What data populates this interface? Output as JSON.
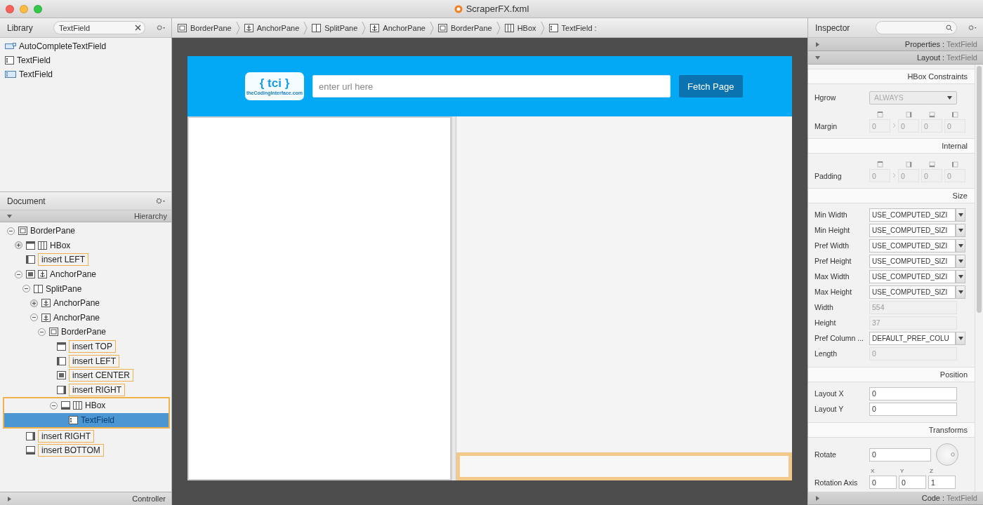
{
  "window": {
    "title": "ScraperFX.fxml"
  },
  "library": {
    "title": "Library",
    "search": {
      "value": "TextField"
    },
    "items": [
      {
        "label": "AutoCompleteTextField",
        "kind": "autocomplete"
      },
      {
        "label": "TextField",
        "kind": "textfield"
      },
      {
        "label": "TextField",
        "kind": "textfield-blue"
      }
    ]
  },
  "document": {
    "title": "Document",
    "section": "Hierarchy",
    "footer": "Controller",
    "tree": [
      {
        "label": "BorderPane",
        "kind": "borderpane",
        "expanded": true,
        "selected": false,
        "outlined": false,
        "children": [
          {
            "label": "HBox",
            "kind": "top-hbox",
            "expanded": false,
            "selected": false,
            "outlined": false
          },
          {
            "label": "insert LEFT",
            "kind": "slot-left"
          },
          {
            "label": "AnchorPane",
            "kind": "center-anchorpane",
            "expanded": true,
            "selected": false,
            "outlined": false,
            "children": [
              {
                "label": "SplitPane",
                "kind": "splitpane",
                "expanded": true,
                "selected": false,
                "outlined": false,
                "children": [
                  {
                    "label": "AnchorPane",
                    "kind": "anchorpane",
                    "expanded": false,
                    "selected": false,
                    "outlined": false
                  },
                  {
                    "label": "AnchorPane",
                    "kind": "anchorpane",
                    "expanded": true,
                    "selected": false,
                    "outlined": false,
                    "children": [
                      {
                        "label": "BorderPane",
                        "kind": "borderpane",
                        "expanded": true,
                        "selected": false,
                        "outlined": false,
                        "children": [
                          {
                            "label": "insert TOP",
                            "kind": "slot-top"
                          },
                          {
                            "label": "insert LEFT",
                            "kind": "slot-left"
                          },
                          {
                            "label": "insert CENTER",
                            "kind": "slot-center"
                          },
                          {
                            "label": "insert RIGHT",
                            "kind": "slot-right"
                          },
                          {
                            "label": "HBox",
                            "kind": "bottom-hbox",
                            "expanded": true,
                            "selected": false,
                            "outlined": true,
                            "children": [
                              {
                                "label": "TextField",
                                "kind": "textfield",
                                "selected": true,
                                "outlined": false
                              }
                            ]
                          }
                        ]
                      }
                    ]
                  }
                ]
              }
            ]
          },
          {
            "label": "insert RIGHT",
            "kind": "slot-right"
          },
          {
            "label": "insert BOTTOM",
            "kind": "slot-bottom"
          }
        ]
      }
    ]
  },
  "breadcrumb": [
    {
      "label": "BorderPane",
      "kind": "borderpane"
    },
    {
      "label": "AnchorPane",
      "kind": "anchorpane"
    },
    {
      "label": "SplitPane",
      "kind": "splitpane"
    },
    {
      "label": "AnchorPane",
      "kind": "anchorpane"
    },
    {
      "label": "BorderPane",
      "kind": "borderpane"
    },
    {
      "label": "HBox",
      "kind": "hbox"
    },
    {
      "label": "TextField :",
      "kind": "textfield"
    }
  ],
  "canvas": {
    "logo": {
      "mark": "{ tci }",
      "caption": "theCodingInterface.com"
    },
    "url_field": {
      "placeholder": "enter url here"
    },
    "button": "Fetch Page",
    "selected_field": {
      "selected": true
    }
  },
  "inspector": {
    "title": "Inspector",
    "sections": [
      {
        "name": "Properties :",
        "target": "TextField",
        "expanded": false
      },
      {
        "name": "Layout :",
        "target": "TextField",
        "expanded": true
      }
    ],
    "groups": [
      {
        "heading": "HBox Constraints",
        "rows": [
          {
            "kind": "select",
            "label": "Hgrow",
            "value": "ALWAYS",
            "disabled": true
          },
          {
            "kind": "insets",
            "label": "Margin",
            "values": [
              "0",
              "0",
              "0",
              "0"
            ],
            "disabled": true
          }
        ]
      },
      {
        "heading": "Internal",
        "rows": [
          {
            "kind": "insets",
            "label": "Padding",
            "values": [
              "0",
              "0",
              "0",
              "0"
            ],
            "disabled": true
          }
        ]
      },
      {
        "heading": "Size",
        "rows": [
          {
            "kind": "combo",
            "label": "Min Width",
            "value": "USE_COMPUTED_SIZI"
          },
          {
            "kind": "combo",
            "label": "Min Height",
            "value": "USE_COMPUTED_SIZI"
          },
          {
            "kind": "combo",
            "label": "Pref Width",
            "value": "USE_COMPUTED_SIZI"
          },
          {
            "kind": "combo",
            "label": "Pref Height",
            "value": "USE_COMPUTED_SIZI"
          },
          {
            "kind": "combo",
            "label": "Max Width",
            "value": "USE_COMPUTED_SIZI"
          },
          {
            "kind": "combo",
            "label": "Max Height",
            "value": "USE_COMPUTED_SIZI"
          },
          {
            "kind": "text",
            "label": "Width",
            "value": "554",
            "disabled": true
          },
          {
            "kind": "text",
            "label": "Height",
            "value": "37",
            "disabled": true
          },
          {
            "kind": "combo",
            "label": "Pref Column ...",
            "value": "DEFAULT_PREF_COLU"
          },
          {
            "kind": "text",
            "label": "Length",
            "value": "0",
            "disabled": true
          }
        ]
      },
      {
        "heading": "Position",
        "rows": [
          {
            "kind": "text",
            "label": "Layout X",
            "value": "0",
            "disabled": false
          },
          {
            "kind": "text",
            "label": "Layout Y",
            "value": "0",
            "disabled": false
          }
        ]
      },
      {
        "heading": "Transforms",
        "rows": [
          {
            "kind": "rotate",
            "label": "Rotate",
            "value": "0"
          },
          {
            "kind": "axis",
            "label": "Rotation Axis",
            "axes": [
              {
                "name": "X",
                "value": "0"
              },
              {
                "name": "Y",
                "value": "0"
              },
              {
                "name": "Z",
                "value": "1"
              }
            ]
          }
        ]
      }
    ],
    "footer": {
      "name": "Code :",
      "target": "TextField",
      "expanded": false
    }
  }
}
